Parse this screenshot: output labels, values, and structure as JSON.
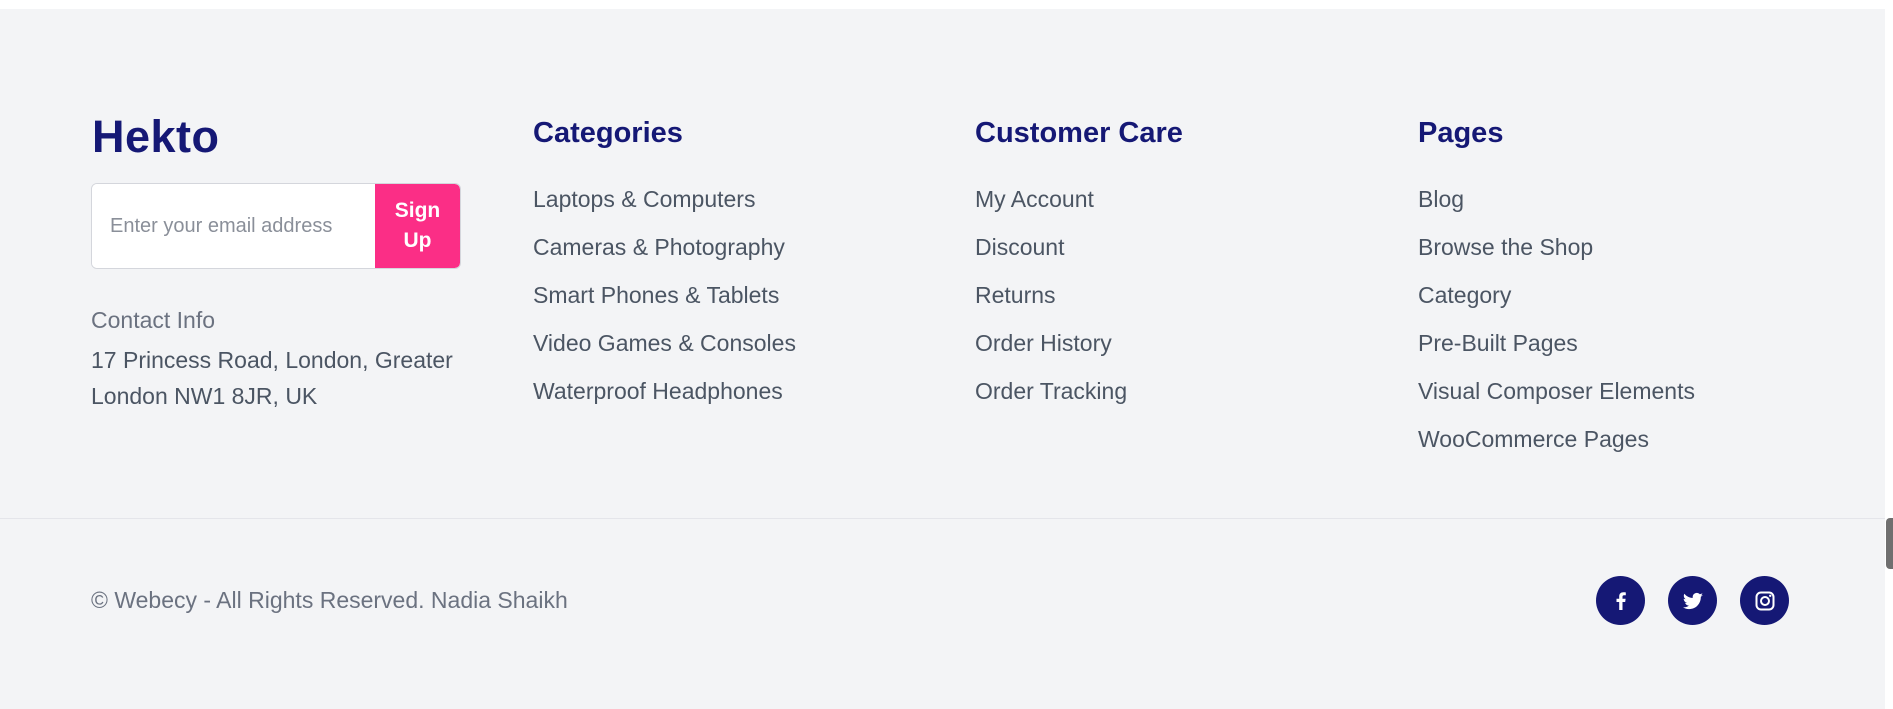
{
  "brand": {
    "name": "Hekto"
  },
  "newsletter": {
    "placeholder": "Enter your email address",
    "button_label": "Sign Up"
  },
  "contact": {
    "title": "Contact Info",
    "address": "17 Princess Road, London, Greater London NW1 8JR, UK"
  },
  "columns": [
    {
      "title": "Categories",
      "links": [
        "Laptops & Computers",
        "Cameras & Photography",
        "Smart Phones & Tablets",
        "Video Games & Consoles",
        "Waterproof Headphones"
      ]
    },
    {
      "title": "Customer Care",
      "links": [
        "My Account",
        "Discount",
        "Returns",
        "Order History",
        "Order Tracking"
      ]
    },
    {
      "title": "Pages",
      "links": [
        "Blog",
        "Browse the Shop",
        "Category",
        "Pre-Built Pages",
        "Visual Composer Elements",
        "WooCommerce Pages"
      ]
    }
  ],
  "copyright": "© Webecy - All Rights Reserved. Nadia Shaikh",
  "social": [
    {
      "icon": "facebook-icon"
    },
    {
      "icon": "twitter-icon"
    },
    {
      "icon": "instagram-icon"
    }
  ],
  "colors": {
    "brand": "#151875",
    "accent": "#fb2e86",
    "background": "#f3f4f6"
  }
}
